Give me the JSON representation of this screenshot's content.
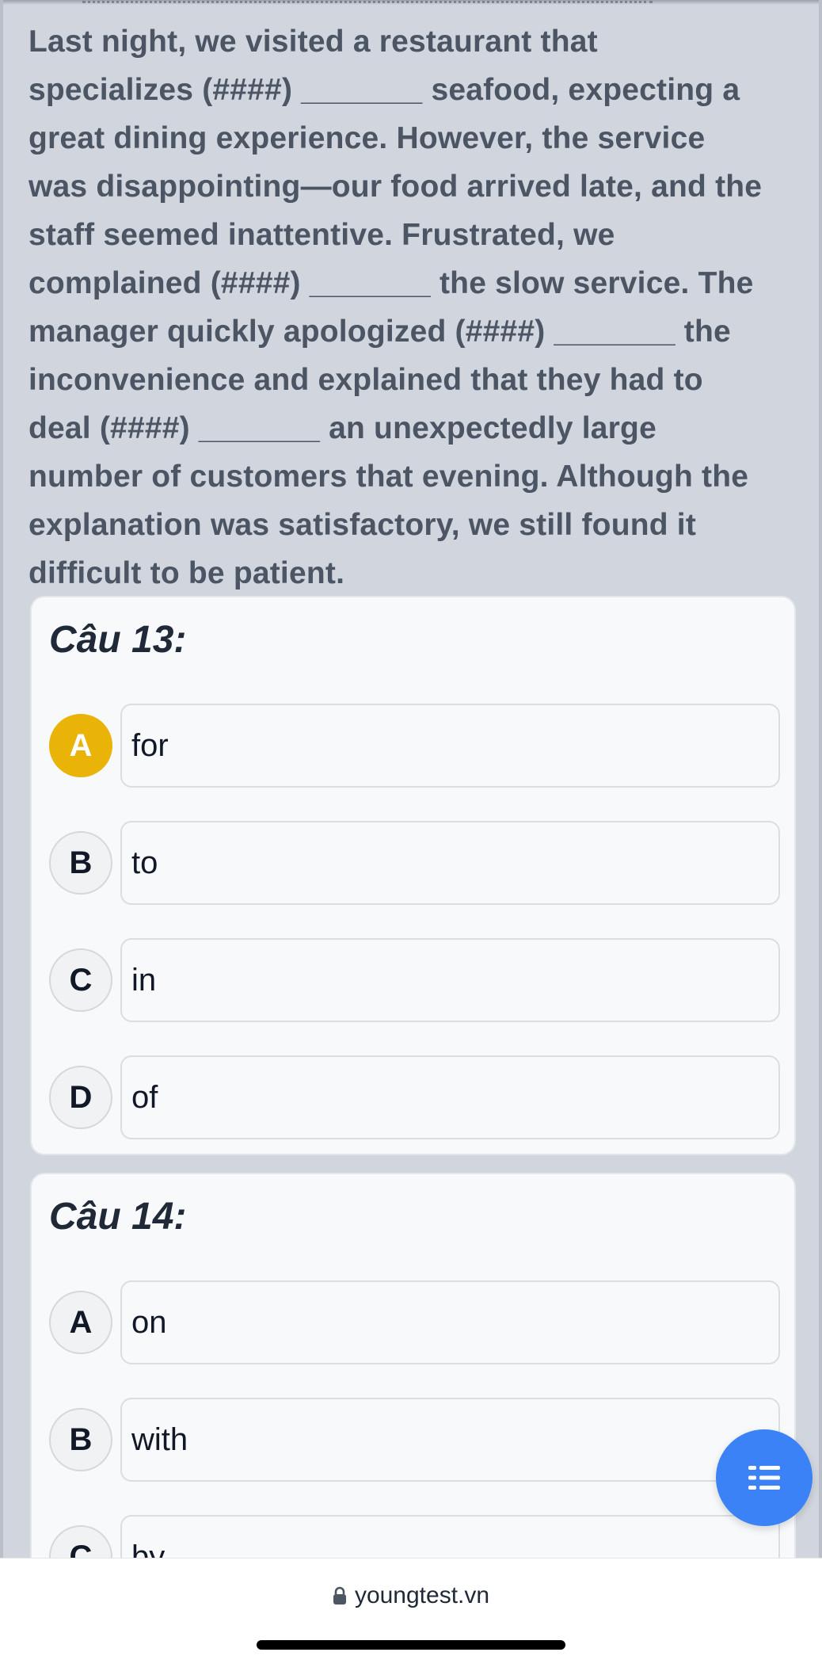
{
  "passage": {
    "lines": [
      "Last night, we visited a restaurant that",
      "specializes (####) _______ seafood, expecting a",
      "great dining experience. However, the service",
      "was disappointing—our food arrived late, and the",
      "staff seemed inattentive. Frustrated, we",
      "complained (####) _______ the slow service. The",
      "manager quickly apologized (####) _______ the",
      "inconvenience and explained that they had to",
      "deal (####) _______ an unexpectedly large",
      "number of customers that evening. Although the",
      "explanation was satisfactory, we still found it",
      "difficult to be patient."
    ]
  },
  "questions": [
    {
      "title": "Câu 13:",
      "selected": "A",
      "options": [
        {
          "letter": "A",
          "text": "for"
        },
        {
          "letter": "B",
          "text": "to"
        },
        {
          "letter": "C",
          "text": "in"
        },
        {
          "letter": "D",
          "text": "of"
        }
      ]
    },
    {
      "title": "Câu 14:",
      "options": [
        {
          "letter": "A",
          "text": "on"
        },
        {
          "letter": "B",
          "text": "with"
        },
        {
          "letter": "C",
          "text": "by"
        }
      ]
    }
  ],
  "fab": {
    "icon": "list-icon"
  },
  "browser": {
    "url": "youngtest.vn",
    "icon": "lock-icon"
  },
  "colors": {
    "selected": "#eab308",
    "fab": "#3b82f6",
    "background": "#d1d5dd"
  }
}
